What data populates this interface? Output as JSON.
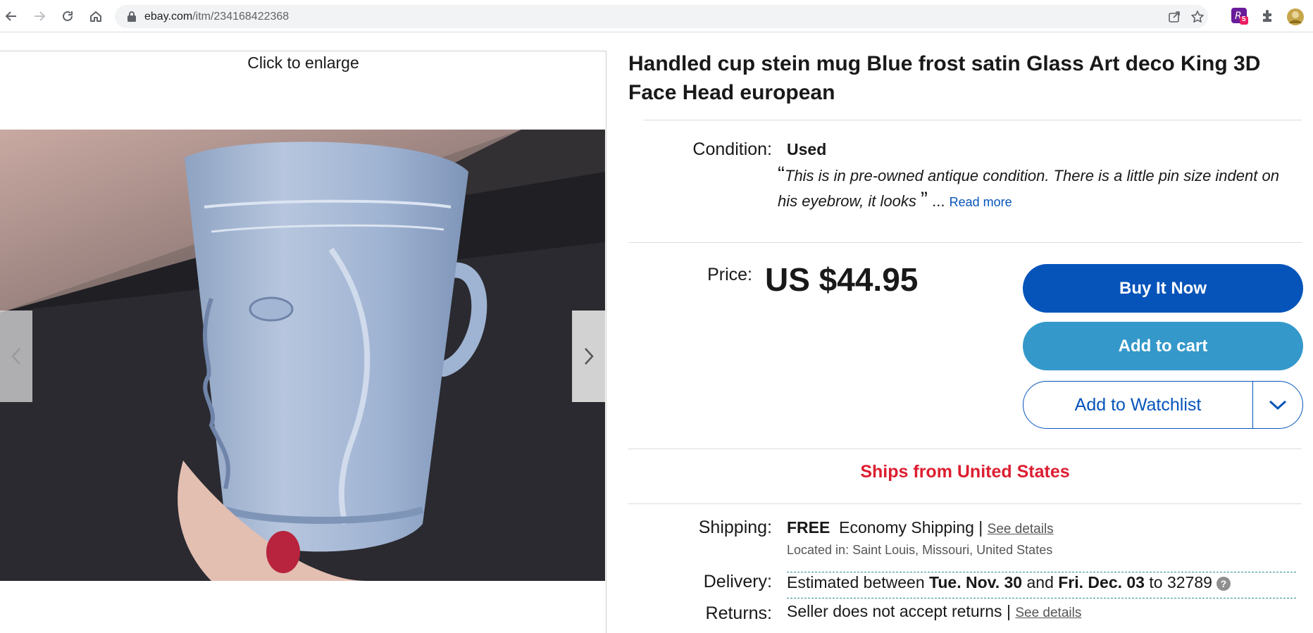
{
  "browser": {
    "url_domain": "ebay.com",
    "url_path": "/itm/234168422368",
    "extension_badge": "5"
  },
  "gallery": {
    "enlarge_label": "Click to enlarge"
  },
  "listing": {
    "title": "Handled cup stein mug Blue frost satin Glass Art deco King 3D Face Head european",
    "condition_label": "Condition:",
    "condition_value": "Used",
    "condition_quote": "This is in pre-owned antique condition. There is a little pin size indent on his eyebrow, it looks",
    "quote_open": "“",
    "quote_close": "”",
    "ellipsis": "...",
    "read_more": "Read more",
    "price_label": "Price:",
    "price_value": "US $44.95",
    "buy_now": "Buy It Now",
    "add_to_cart": "Add to cart",
    "add_to_watchlist": "Add to Watchlist",
    "ships_from": "Ships from United States",
    "shipping_label": "Shipping:",
    "shipping_free": "FREE",
    "shipping_method": "Economy Shipping |",
    "shipping_details": "See details",
    "located_in": "Located in:  Saint Louis, Missouri, United States",
    "delivery_label": "Delivery:",
    "delivery_prefix": "Estimated between",
    "delivery_start": "Tue. Nov. 30",
    "delivery_and": "and",
    "delivery_end": "Fri. Dec. 03",
    "delivery_to": "to 32789",
    "help_glyph": "?",
    "returns_label": "Returns:",
    "returns_text": "Seller does not accept returns |",
    "returns_details": "See details"
  },
  "colors": {
    "buy_now": "#0654ba",
    "add_to_cart": "#3498ca",
    "ships_from": "#dd1e31"
  }
}
